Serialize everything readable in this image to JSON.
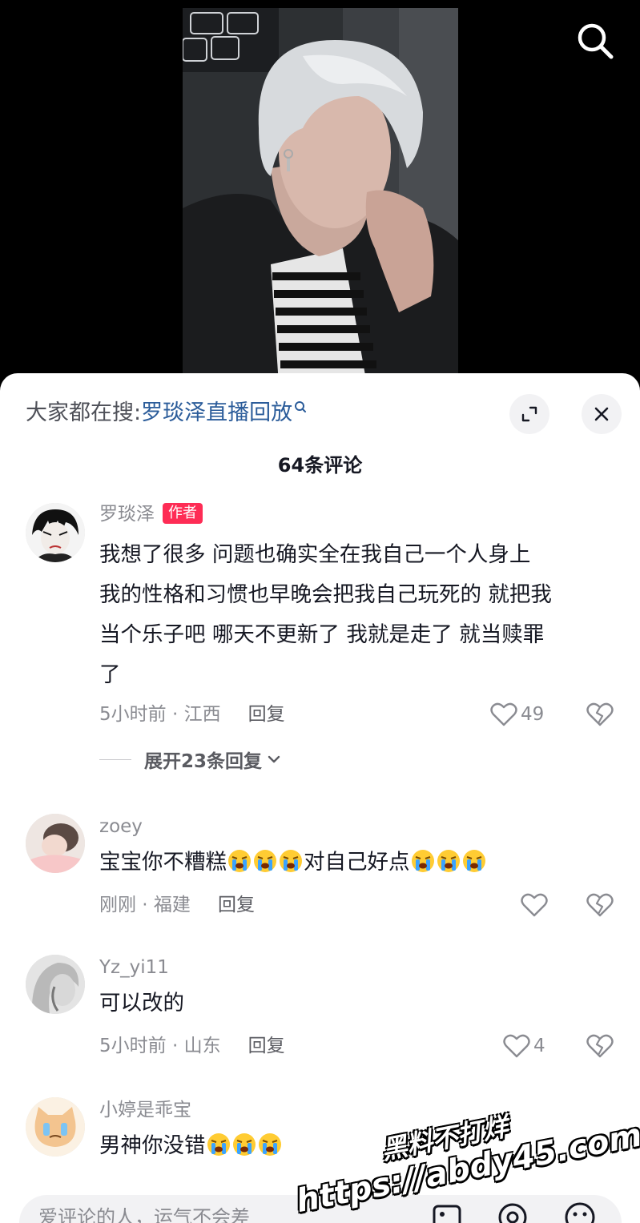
{
  "video": {
    "search_icon": "search-icon"
  },
  "sheet": {
    "search_prefix": "大家都在搜:",
    "search_term": "罗琰泽直播回放",
    "comment_count": "64条评论",
    "expand_icon": "expand-icon",
    "close_icon": "close-icon"
  },
  "comments": [
    {
      "username": "罗琰泽",
      "tag": "作者",
      "text_lines": [
        "我想了很多 问题也确实全在我自己一个人身上",
        "我的性格和习惯也早晚会把我自己玩死的 就把我",
        "当个乐子吧 哪天不更新了 我就是走了 就当赎罪",
        "了"
      ],
      "time_location": "5小时前 · 江西",
      "reply_label": "回复",
      "likes": "49",
      "expand_replies": "展开23条回复"
    },
    {
      "username": "zoey",
      "text_before": "宝宝你不糟糕",
      "text_after": "对自己好点",
      "emoji": "loudly-crying-emoji",
      "time_location": "刚刚 · 福建",
      "reply_label": "回复",
      "likes": ""
    },
    {
      "username": "Yz_yi11",
      "text": "可以改的",
      "time_location": "5小时前 · 山东",
      "reply_label": "回复",
      "likes": "4"
    },
    {
      "username": "小婷是乖宝",
      "text": "男神你没错",
      "emoji": "loudly-crying-emoji"
    }
  ],
  "input_bar": {
    "placeholder": "爱评论的人，运气不会差",
    "icons": [
      "image-icon",
      "at-icon",
      "emoji-icon"
    ]
  },
  "watermark": {
    "line1": "黑料不打烊",
    "line2": "https://abdy45.com"
  },
  "colors": {
    "author_tag": "#fe2c55",
    "search_term": "#2b5c9a",
    "sheet_bg": "#ffffff",
    "secondary_text": "#8a8b91"
  }
}
